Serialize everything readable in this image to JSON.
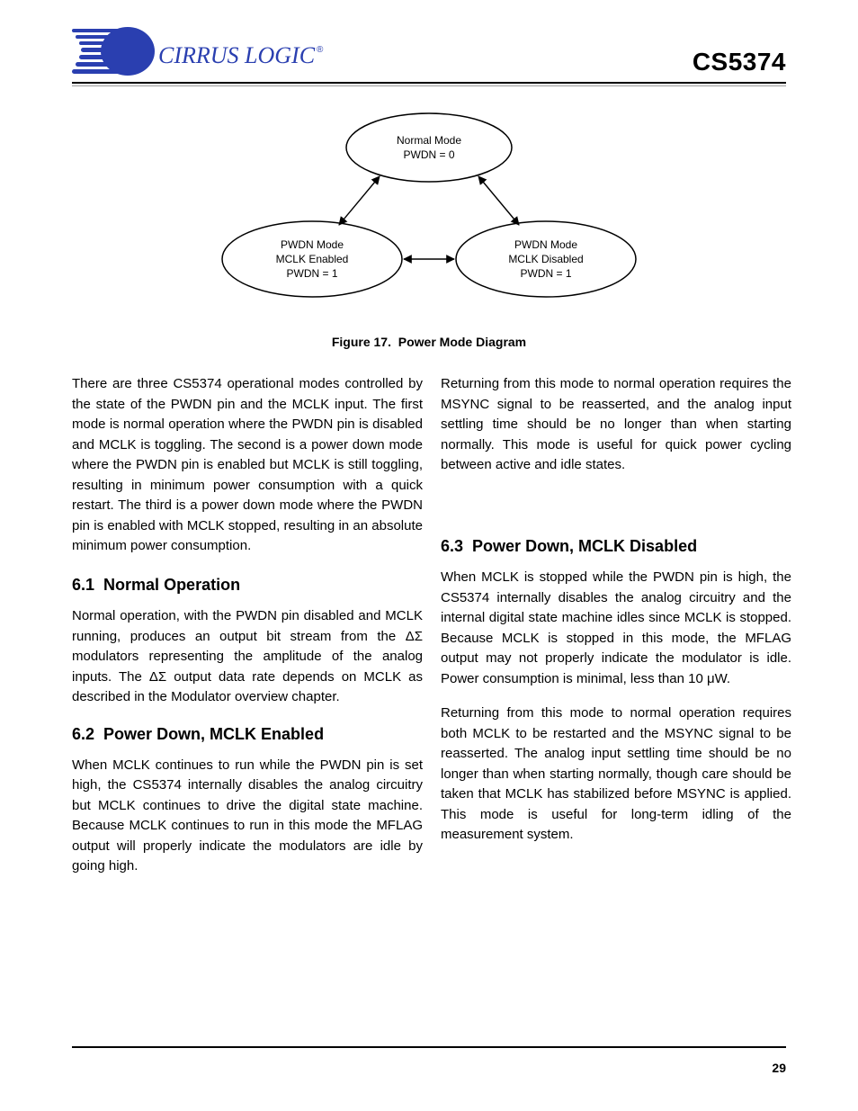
{
  "header": {
    "part": "CS5374",
    "logo_brand": "CIRRUS LOGIC",
    "logo_tm": "®"
  },
  "figure": {
    "top_state_l1": "Normal Mode",
    "top_state_l2": "PWDN = 0",
    "left_state_l1": "PWDN Mode",
    "left_state_l2": "MCLK Enabled",
    "left_state_l3": "PWDN = 1",
    "right_state_l1": "PWDN Mode",
    "right_state_l2": "MCLK Disabled",
    "right_state_l3": "PWDN = 1",
    "caption_no": "Figure 17.",
    "caption_txt": "Power Mode Diagram"
  },
  "col_left": {
    "intro": "There are three CS5374 operational modes controlled by the state of the PWDN pin and the MCLK input. The first mode is normal operation where the PWDN pin is disabled and MCLK is toggling. The second is a power down mode where the PWDN pin is enabled but MCLK is still toggling, resulting in minimum power consumption with a quick restart. The third is a power down mode where the PWDN pin is enabled with MCLK stopped, resulting in an absolute minimum power consumption.",
    "h61_no": "6.1",
    "h61_txt": "Normal Operation",
    "p61": "Normal operation, with the PWDN pin disabled and MCLK running, produces an output bit stream from the ΔΣ modulators representing the amplitude of the analog inputs. The ΔΣ output data rate depends on MCLK as described in the Modulator overview chapter.",
    "h62_no": "6.2",
    "h62_txt": "Power Down, MCLK Enabled",
    "p62": "When MCLK continues to run while the PWDN pin is set high, the CS5374 internally disables the analog circuitry but MCLK continues to drive the digital state machine. Because MCLK continues to run in this mode the MFLAG output will properly indicate the modulators are idle by going high."
  },
  "col_right": {
    "pR1": "Returning from this mode to normal operation requires the MSYNC signal to be reasserted, and the analog input settling time should be no longer than when starting normally. This mode is useful for quick power cycling between active and idle states.",
    "h63_no": "6.3",
    "h63_txt": "Power Down, MCLK Disabled",
    "p63a": "When MCLK is stopped while the PWDN pin is high, the CS5374 internally disables the analog circuitry and the internal digital state machine idles since MCLK is stopped. Because MCLK is stopped in this mode, the MFLAG output may not properly indicate the modulator is idle. Power consumption is minimal, less than 10 μW.",
    "p63b": "Returning from this mode to normal operation requires both MCLK to be restarted and the MSYNC signal to be reasserted. The analog input settling time should be no longer than when starting normally, though care should be taken that MCLK has stabilized before MSYNC is applied. This mode is useful for long-term idling of the measurement system."
  },
  "page_number": "29"
}
